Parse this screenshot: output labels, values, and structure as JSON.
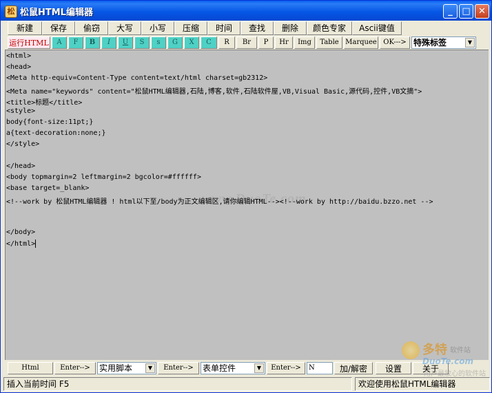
{
  "window": {
    "title": "松鼠HTML编辑器",
    "app_icon": "squirrel-app-icon",
    "controls": [
      {
        "name": "minimize-button",
        "glyph": "_"
      },
      {
        "name": "maximize-button",
        "glyph": "□"
      },
      {
        "name": "close-button",
        "glyph": "✕"
      }
    ]
  },
  "toolbar1": [
    "新建",
    "保存",
    "偷窃",
    "大写",
    "小写",
    "压缩",
    "时间",
    "查找",
    "删除",
    "颜色专家",
    "Ascii键值"
  ],
  "toolbar2": {
    "run_label": "运行HTML",
    "tags": [
      "A",
      "F",
      "B",
      "I",
      "U",
      "S",
      "s",
      "G",
      "X",
      "C",
      "R",
      "Br",
      "P",
      "Hr",
      "Img",
      "Table",
      "Marquee",
      "OK--->"
    ],
    "special_combo": "特殊标签"
  },
  "editor": {
    "lines": [
      "<html>",
      "<head>",
      "<Meta http-equiv=Content-Type content=text/html charset=gb2312>",
      "<Meta name=\"keywords\" content=\"松鼠HTML编辑器,石陆,博客,软件,石陆软件屋,VB,Visual Basic,源代码,控件,VB文摘\">",
      "<title>标题</title>",
      "<style>",
      "body{font-size:11pt;}",
      "a{text-decoration:none;}",
      "</style>",
      "",
      "</head>",
      "<body topmargin=2 leftmargin=2 bgcolor=#ffffff>",
      "<base target=_blank>",
      "<!--work by 松鼠HTML编辑器 ! html以下至/body为正文编辑区,请你编辑HTML--><!--work by http://baidu.bzzo.net -->",
      "",
      "",
      "</body>",
      "</html>"
    ],
    "watermark": "www.DuoTe.com"
  },
  "bottombar": {
    "html_label": "Html",
    "enter1_label": "Enter-->",
    "script_combo": "实用脚本",
    "enter2_label": "Enter-->",
    "form_combo": "表单控件",
    "enter3_label": "Enter-->",
    "n_field": "N",
    "encrypt_label": "加/解密",
    "settings_label": "设置",
    "about_label": "关于"
  },
  "status": {
    "hint": "插入当前时间   F5",
    "welcome": "欢迎使用松鼠HTML编辑器"
  },
  "logo": {
    "title": "多特",
    "subtitle": "软件站",
    "url": "DuoTe.com",
    "tagline": "用户最放心的软件站"
  },
  "colors": {
    "title_bar": "#0a5ff0",
    "editor_bg": "#c0c0c0",
    "tag_button_teal": "#4fd1c5",
    "run_button_text": "#c00000"
  }
}
